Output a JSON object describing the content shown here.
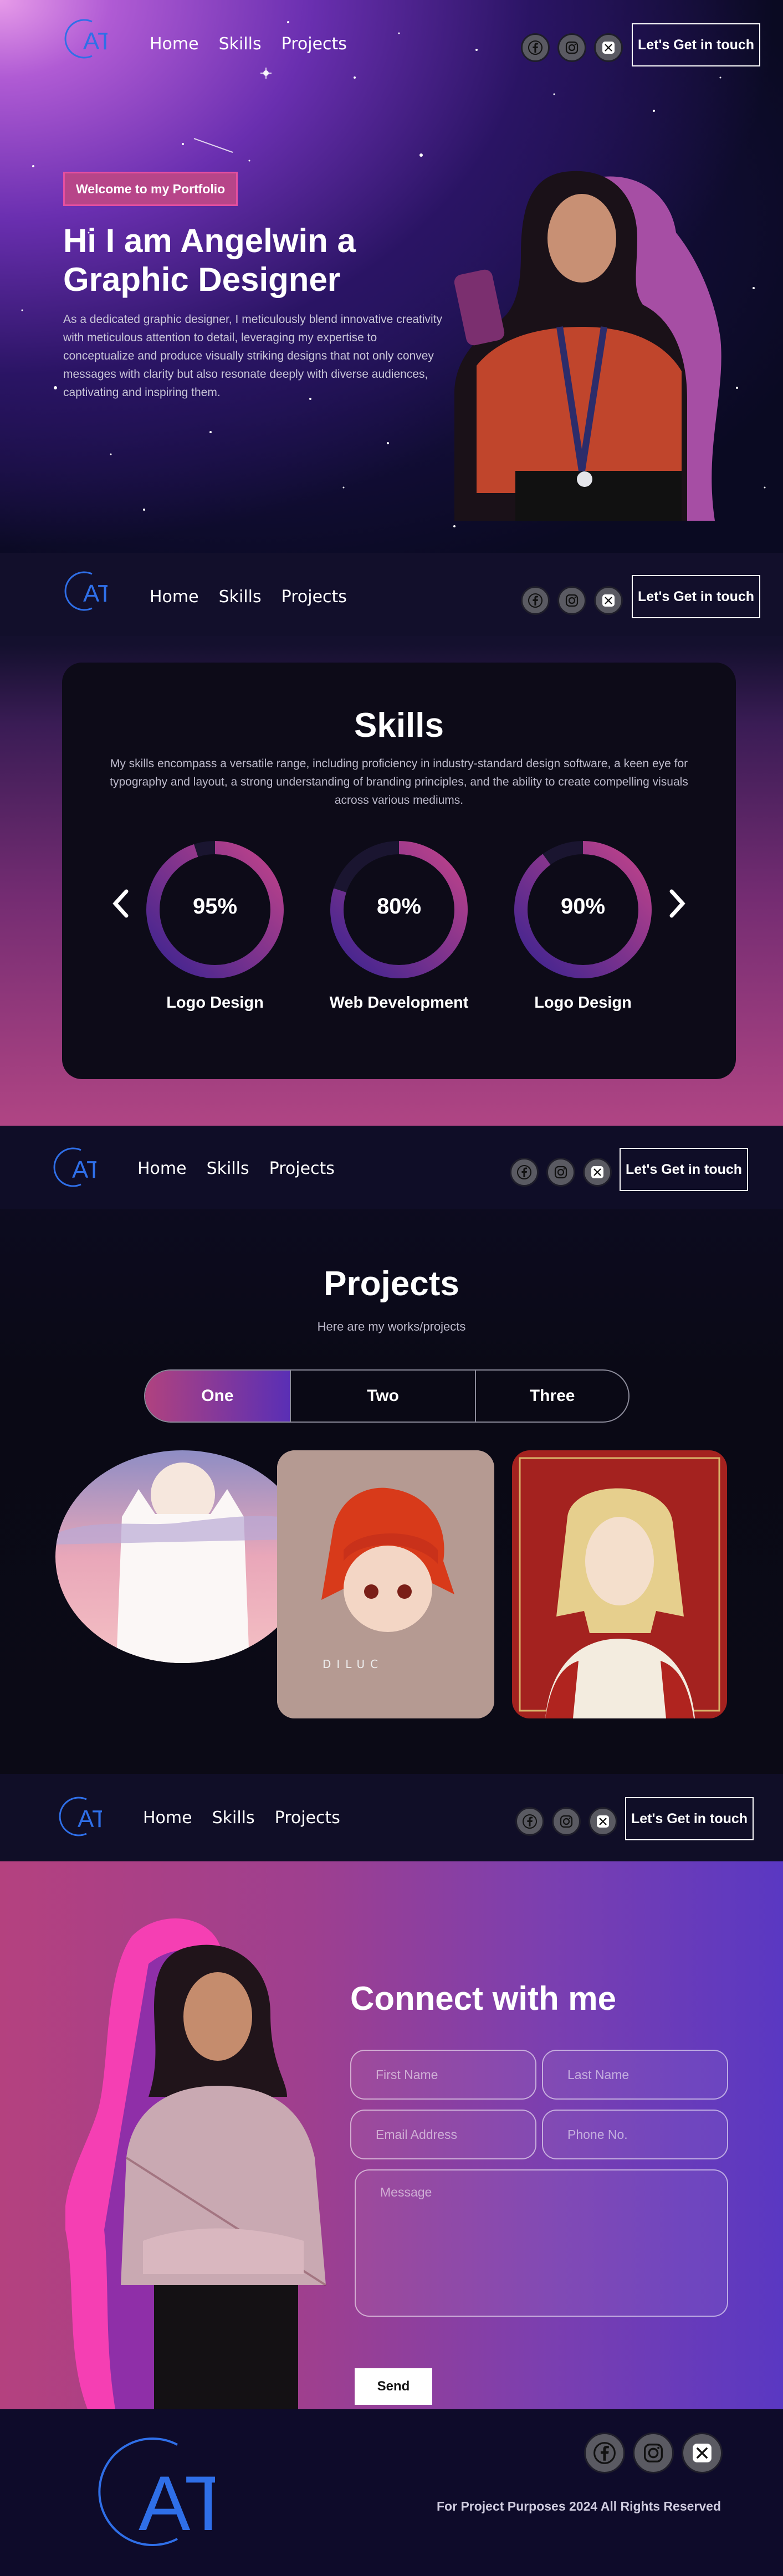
{
  "nav": {
    "logo_text": "AT",
    "links": [
      "Home",
      "Skills",
      "Projects"
    ],
    "cta_label": "Let's Get in touch",
    "social_icons": [
      "facebook-icon",
      "instagram-icon",
      "x-icon"
    ]
  },
  "hero": {
    "badge": "Welcome to my Portfolio",
    "title": "Hi I am Angelwin a Graphic Designer",
    "description": "As a dedicated graphic designer, I meticulously blend innovative creativity with meticulous attention to detail, leveraging my expertise to conceptualize and produce visually striking designs that not only convey messages with clarity but also resonate deeply with diverse audiences, captivating and inspiring them."
  },
  "skills": {
    "title": "Skills",
    "description": "My skills encompass a versatile range, including proficiency in industry-standard design software, a keen eye for typography and layout, a strong understanding of branding principles, and the ability to create compelling visuals across various mediums.",
    "items": [
      {
        "value": "95%",
        "percent": 95,
        "label": "Logo Design"
      },
      {
        "value": "80%",
        "percent": 80,
        "label": "Web Development"
      },
      {
        "value": "90%",
        "percent": 90,
        "label": "Logo Design"
      }
    ]
  },
  "projects": {
    "title": "Projects",
    "subtitle": "Here are my works/projects",
    "tabs": [
      "One",
      "Two",
      "Three"
    ],
    "active_tab": "One",
    "image_watermark": "DILUC"
  },
  "contact": {
    "title": "Connect with me",
    "first_name_placeholder": "First Name",
    "last_name_placeholder": "Last Name",
    "email_placeholder": "Email Address",
    "phone_placeholder": "Phone No.",
    "message_placeholder": "Message",
    "send_label": "Send"
  },
  "footer": {
    "logo_text": "AT",
    "copyright": "For Project Purposes 2024 All Rights Reserved"
  },
  "colors": {
    "accent_pink": "#b74589",
    "accent_purple": "#5a2fb5",
    "logo_blue": "#2f6fe8"
  }
}
